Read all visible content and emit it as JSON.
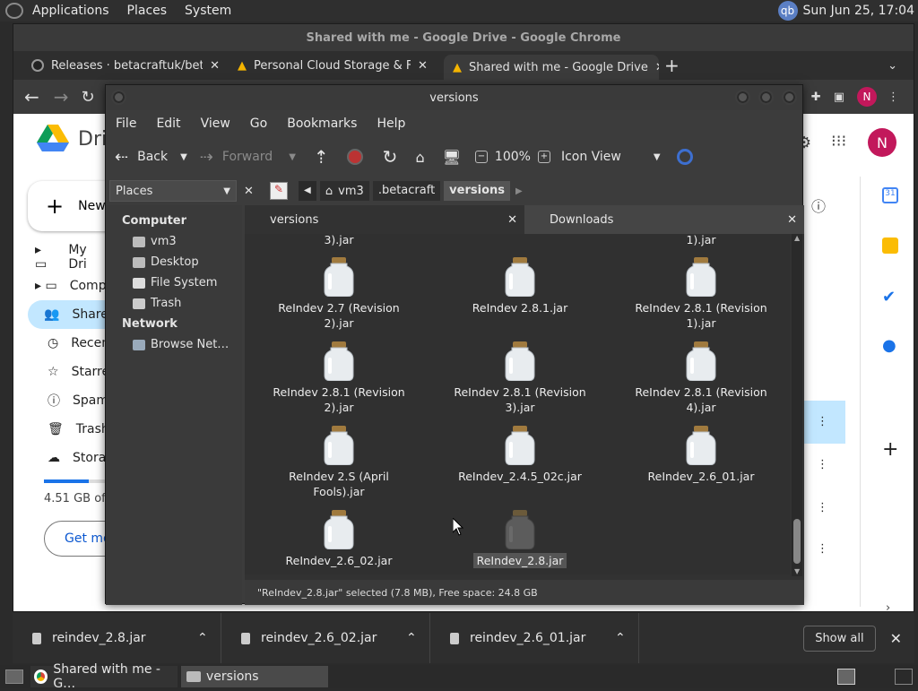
{
  "top_panel": {
    "applications": "Applications",
    "places": "Places",
    "system": "System",
    "clock": "Sun Jun 25, 17:04",
    "user_badge": "qb"
  },
  "chrome": {
    "title": "Shared with me - Google Drive - Google Chrome",
    "tabs": [
      {
        "label": "Releases · betacraftuk/betacra"
      },
      {
        "label": "Personal Cloud Storage & File"
      },
      {
        "label": "Shared with me - Google Drive"
      }
    ],
    "profile_initial": "N"
  },
  "drive": {
    "logo_text": "Drive",
    "new_label": "New",
    "nav": [
      {
        "label": "My Dri"
      },
      {
        "label": "Comp"
      },
      {
        "label": "Share"
      },
      {
        "label": "Recen"
      },
      {
        "label": "Starre"
      },
      {
        "label": "Spam"
      },
      {
        "label": "Trash"
      },
      {
        "label": "Storag"
      }
    ],
    "storage_text": "4.51 GB of 1",
    "get_more": "Get mo",
    "avatar": "N"
  },
  "nemo": {
    "title": "versions",
    "menu": [
      "File",
      "Edit",
      "View",
      "Go",
      "Bookmarks",
      "Help"
    ],
    "toolbar": {
      "back": "Back",
      "forward": "Forward",
      "zoom": "100%",
      "view": "Icon View"
    },
    "path": [
      "vm3",
      ".betacraft",
      "versions"
    ],
    "places_label": "Places",
    "sidebar": {
      "computer": "Computer",
      "computer_items": [
        "vm3",
        "Desktop",
        "File System",
        "Trash"
      ],
      "network": "Network",
      "network_items": [
        "Browse Net…"
      ]
    },
    "tabs": [
      "versions",
      "Downloads"
    ],
    "partial_top": [
      "3).jar",
      "1).jar"
    ],
    "files": [
      "ReIndev 2.7 (Revision 2).jar",
      "ReIndev 2.8.1.jar",
      "ReIndev 2.8.1 (Revision 1).jar",
      "ReIndev 2.8.1 (Revision 2).jar",
      "ReIndev 2.8.1 (Revision 3).jar",
      "ReIndev 2.8.1 (Revision 4).jar",
      "ReIndev 2.S (April Fools).jar",
      "ReIndev_2.4.5_02c.jar",
      "ReIndev_2.6_01.jar",
      "ReIndev_2.6_02.jar",
      "ReIndev_2.8.jar"
    ],
    "status": "\"ReIndev_2.8.jar\" selected (7.8 MB), Free space: 24.8 GB"
  },
  "downloads": {
    "items": [
      "reindev_2.8.jar",
      "reindev_2.6_02.jar",
      "reindev_2.6_01.jar"
    ],
    "show_all": "Show all"
  },
  "taskbar": {
    "items": [
      "Shared with me - G…",
      "versions"
    ]
  }
}
